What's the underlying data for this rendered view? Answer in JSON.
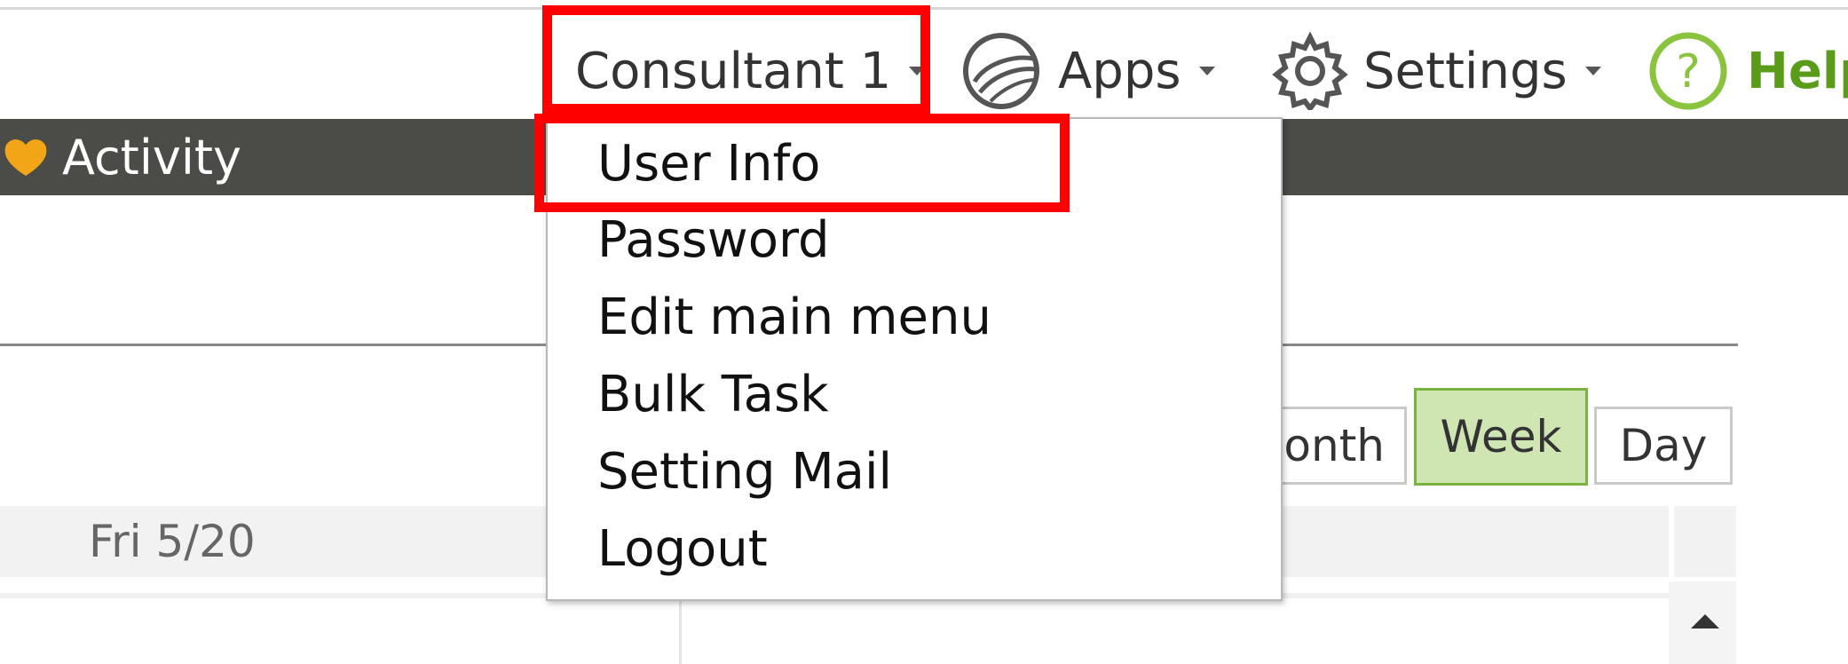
{
  "header": {
    "user_menu_label": "Consultant 1",
    "apps_label": "Apps",
    "settings_label": "Settings",
    "help_label": "Help"
  },
  "nav": {
    "activity_label": "Activity"
  },
  "user_dropdown": {
    "items": [
      "User Info",
      "Password",
      "Edit main menu",
      "Bulk Task",
      "Setting Mail",
      "Logout"
    ]
  },
  "calendar": {
    "view_buttons": {
      "month": "onth",
      "week": "Week",
      "day": "Day"
    },
    "selected_view": "Week",
    "day_header": "Fri 5/20"
  },
  "colors": {
    "highlight_box": "#ff0000",
    "dark_bar": "#4b4b47",
    "week_selected_bg": "#cfe5b2",
    "week_selected_border": "#79b23c",
    "help_green": "#8ac43f",
    "help_text": "#5a9b1a",
    "activity_icon": "#f2a516"
  }
}
